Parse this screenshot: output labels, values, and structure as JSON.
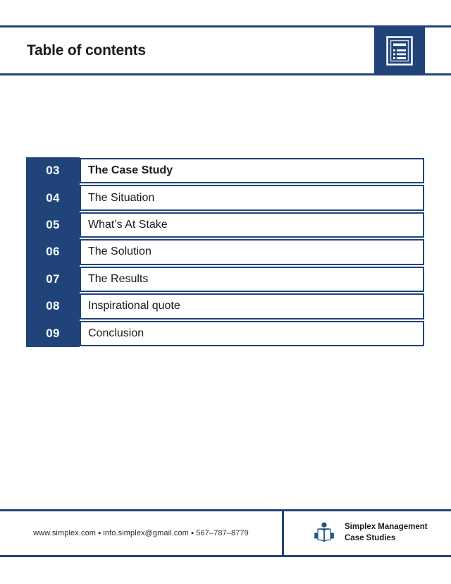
{
  "header": {
    "title": "Table of contents",
    "icon": "document-list-icon"
  },
  "toc": {
    "rows": [
      {
        "number": "03",
        "label": "The Case Study",
        "bold": true
      },
      {
        "number": "04",
        "label": "The Situation",
        "bold": false
      },
      {
        "number": "05",
        "label": "What’s At Stake",
        "bold": false
      },
      {
        "number": "06",
        "label": "The Solution",
        "bold": false
      },
      {
        "number": "07",
        "label": "The Results",
        "bold": false
      },
      {
        "number": "08",
        "label": "Inspirational quote",
        "bold": false
      },
      {
        "number": "09",
        "label": "Conclusion",
        "bold": false
      }
    ]
  },
  "footer": {
    "contact": "www.simplex.com ▪ info.simplex@gmail.com ▪ 567–787–8779",
    "logo_icon": "open-book-reader-icon",
    "brand_line1": "Simplex Management",
    "brand_line2": "Case Studies"
  },
  "colors": {
    "accent_blue": "#20447a",
    "text_dark": "#1a1a1a",
    "page_background": "#ffffff"
  }
}
